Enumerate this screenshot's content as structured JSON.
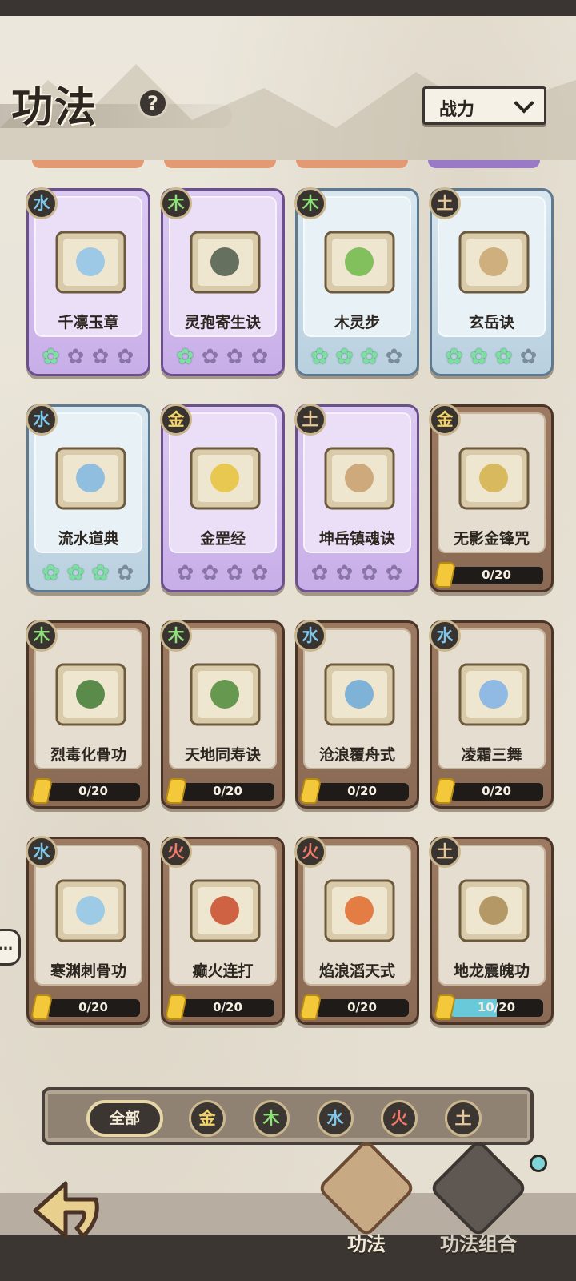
{
  "header": {
    "title": "功法",
    "help_glyph": "?",
    "sort_label": "战力"
  },
  "cards": [
    {
      "element": "水",
      "name": "千凛玉章",
      "style": "purple",
      "stars_on": 1,
      "stars_total": 4,
      "art": "ice-shards"
    },
    {
      "element": "木",
      "name": "灵孢寄生诀",
      "style": "purple",
      "stars_on": 1,
      "stars_total": 4,
      "art": "spore-creature"
    },
    {
      "element": "木",
      "name": "木灵步",
      "style": "blue",
      "stars_on": 3,
      "stars_total": 4,
      "art": "leaves"
    },
    {
      "element": "土",
      "name": "玄岳诀",
      "style": "blue",
      "stars_on": 3,
      "stars_total": 4,
      "art": "earth-fist"
    },
    {
      "element": "水",
      "name": "流水道典",
      "style": "blue",
      "stars_on": 3,
      "stars_total": 4,
      "art": "water-wave"
    },
    {
      "element": "金",
      "name": "金罡经",
      "style": "purple",
      "stars_on": 0,
      "stars_total": 4,
      "art": "gold-arrows"
    },
    {
      "element": "土",
      "name": "坤岳镇魂诀",
      "style": "purple",
      "stars_on": 0,
      "stars_total": 4,
      "art": "rock-spikes"
    },
    {
      "element": "金",
      "name": "无影金锋咒",
      "style": "brown",
      "progress": "0/20",
      "progress_value": 0,
      "art": "golden-blade"
    },
    {
      "element": "木",
      "name": "烈毒化骨功",
      "style": "brown",
      "progress": "0/20",
      "progress_value": 0,
      "art": "poison-turtle"
    },
    {
      "element": "木",
      "name": "天地同寿诀",
      "style": "brown",
      "progress": "0/20",
      "progress_value": 0,
      "art": "green-flame"
    },
    {
      "element": "水",
      "name": "沧浪覆舟式",
      "style": "brown",
      "progress": "0/20",
      "progress_value": 0,
      "art": "blue-wave"
    },
    {
      "element": "水",
      "name": "凌霜三舞",
      "style": "brown",
      "progress": "0/20",
      "progress_value": 0,
      "art": "frost-crystal"
    },
    {
      "element": "水",
      "name": "寒渊刺骨功",
      "style": "brown",
      "progress": "0/20",
      "progress_value": 0,
      "art": "ice-crystal"
    },
    {
      "element": "火",
      "name": "癫火连打",
      "style": "brown",
      "progress": "0/20",
      "progress_value": 0,
      "art": "fire-orb"
    },
    {
      "element": "火",
      "name": "焰浪滔天式",
      "style": "brown",
      "progress": "0/20",
      "progress_value": 0,
      "art": "flame-wave"
    },
    {
      "element": "土",
      "name": "地龙震魄功",
      "style": "brown",
      "progress": "10/20",
      "progress_value": 0.5,
      "art": "earth-dragon"
    }
  ],
  "side": {
    "chat_glyph": "…"
  },
  "filter": {
    "all_label": "全部",
    "elements": [
      {
        "label": "金",
        "color": "#f2d46a"
      },
      {
        "label": "木",
        "color": "#8fe07b"
      },
      {
        "label": "水",
        "color": "#7fc7ea"
      },
      {
        "label": "火",
        "color": "#f07a6a"
      },
      {
        "label": "土",
        "color": "#e8c79a"
      }
    ]
  },
  "nav": {
    "tab_skills": "功法",
    "tab_combos": "功法组合"
  },
  "colors": {
    "element_colors": {
      "金": "#f2d46a",
      "木": "#8fe07b",
      "水": "#7fc7ea",
      "火": "#f07a6a",
      "土": "#e8c79a"
    }
  }
}
